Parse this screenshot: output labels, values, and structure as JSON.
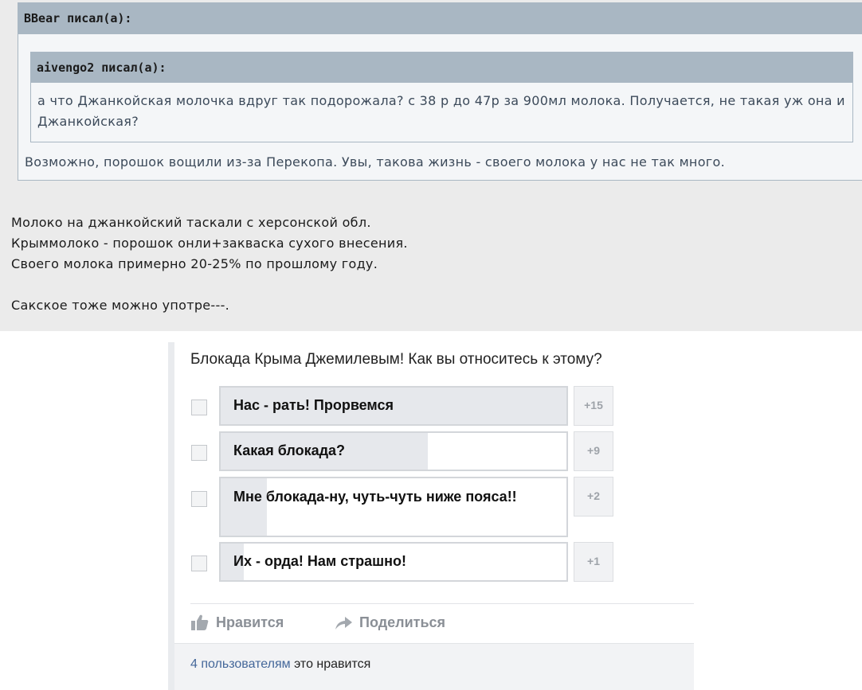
{
  "post": {
    "outer_quote": {
      "author": "BBear писал(а):",
      "inner_quote": {
        "author": "aivengo2 писал(а):",
        "text": "а что Джанкойская молочка вдруг так подорожала? с 38 р до 47р за 900мл молока. Получается, не такая уж она и Джанкойская?"
      },
      "text": "Возможно, порошок вощили из-за Перекопа. Увы, такова жизнь - своего молока у нас не так много."
    },
    "reply_lines": [
      "Молоко на джанкойский таскали с херсонской обл.",
      "Крыммолоко - порошок онли+закваска сухого внесения.",
      "Своего молока примерно 20-25% по прошлому году.",
      "",
      "Сакское тоже можно употре---."
    ]
  },
  "poll": {
    "question": "Блокада Крыма Джемилевым! Как вы относитесь к этому?",
    "options": [
      {
        "label": "Нас - рать! Прорвемся",
        "count": "+15",
        "votes": 15
      },
      {
        "label": "Какая блокада?",
        "count": "+9",
        "votes": 9
      },
      {
        "label": "Мне блокада-ну, чуть-чуть ниже пояса!!",
        "count": "+2",
        "votes": 2
      },
      {
        "label": "Их - орда! Нам страшно!",
        "count": "+1",
        "votes": 1
      }
    ],
    "actions": {
      "like": "Нравится",
      "share": "Поделиться"
    },
    "likes": {
      "link": "4 пользователям",
      "text": " это нравится"
    }
  },
  "icons": {
    "like": "thumbs-up-icon",
    "share": "share-arrow-icon"
  },
  "colors": {
    "quote_header": "#a9b7c3",
    "quote_text": "#3c4a5a",
    "link": "#44679a",
    "bar_fill": "#e6e8ec"
  }
}
